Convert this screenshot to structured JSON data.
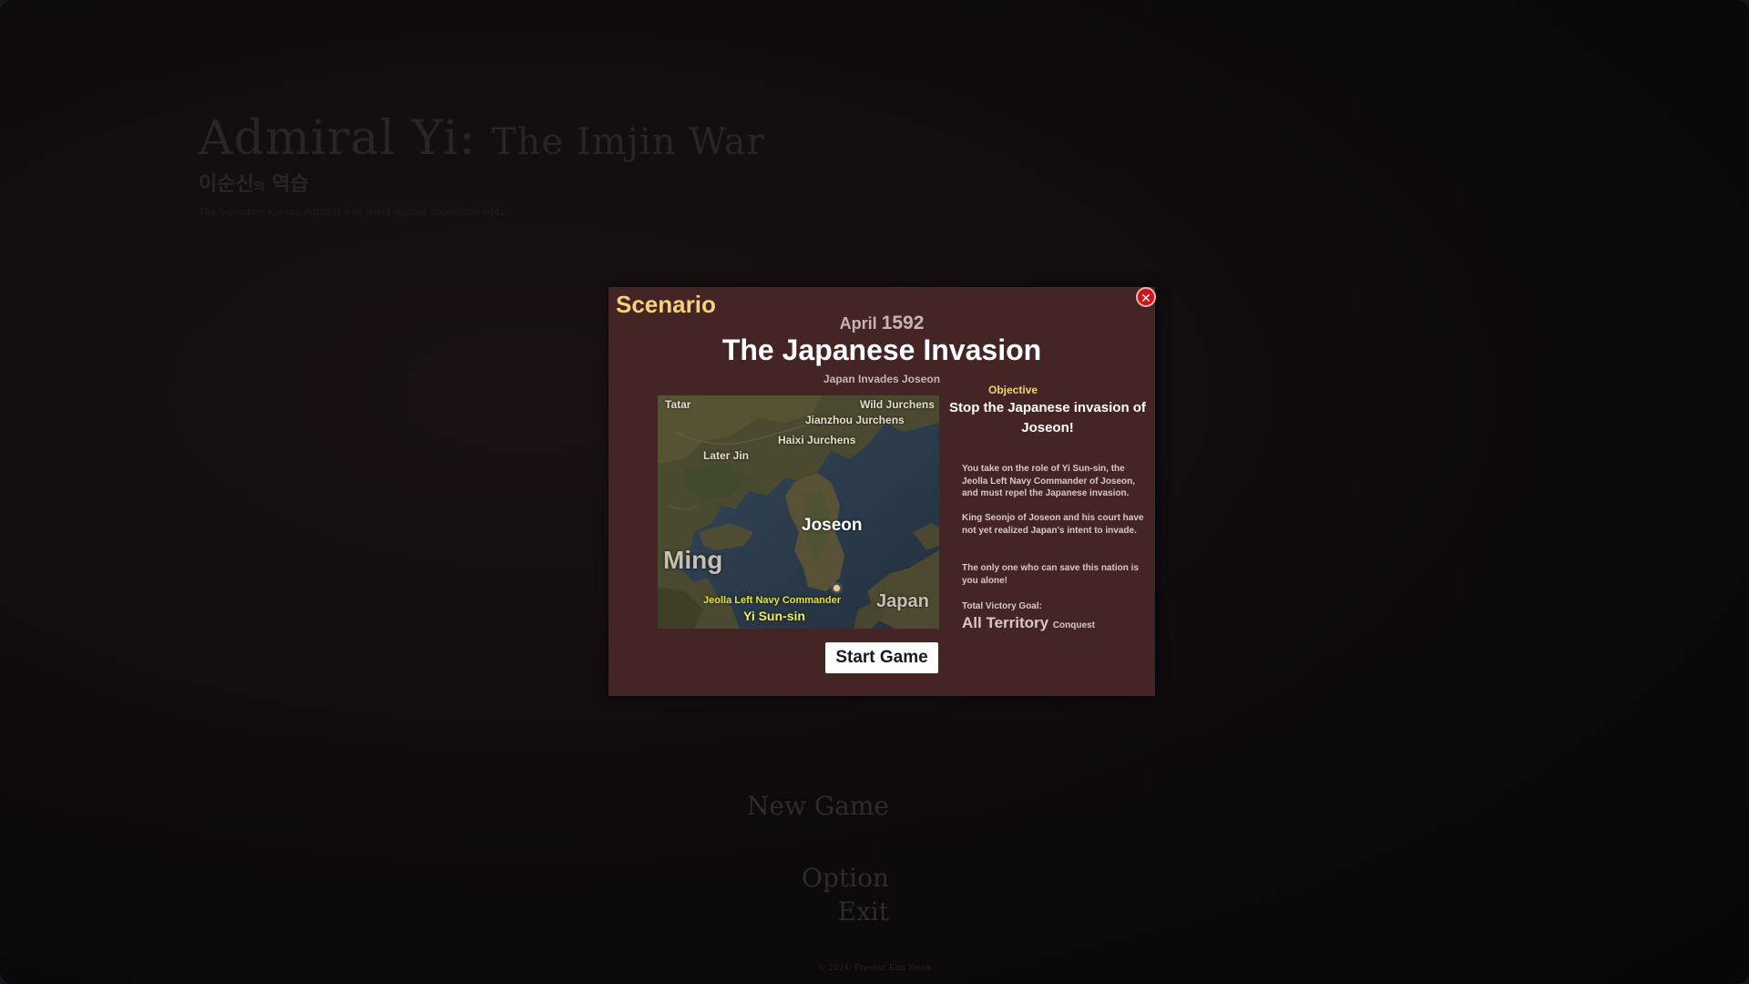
{
  "background": {
    "title_main": "Admiral Yi:",
    "title_sub": "The Imjin War",
    "title_korean_main": "이순신",
    "title_korean_small": "의",
    "title_korean_end": "역습",
    "tagline": "The legendary Korean Admiral who stood against impossible odds.",
    "menu": {
      "new_game": "New Game",
      "option": "Option",
      "exit": "Exit"
    },
    "copyright": "© 2024- Present Kim Yosok"
  },
  "modal": {
    "title": "Scenario",
    "close_symbol": "✕",
    "date_month": "April",
    "date_year": "1592",
    "scenario_name": "The Japanese Invasion",
    "scenario_subtitle": "Japan Invades Joseon",
    "map": {
      "labels": {
        "tatar": "Tatar",
        "wild_jurchens": "Wild Jurchens",
        "jianzhou_jurchens": "Jianzhou Jurchens",
        "haixi_jurchens": "Haixi Jurchens",
        "later_jin": "Later Jin",
        "joseon": "Joseon",
        "ming": "Ming",
        "japan": "Japan",
        "commander_title": "Jeolla Left Navy Commander",
        "commander_name": "Yi Sun-sin"
      }
    },
    "objective_label": "Objective",
    "objective_text": "Stop the Japanese invasion of Joseon!",
    "description": [
      "You take on the role of Yi Sun-sin, the Jeolla Left Navy Commander of Joseon, and must repel the Japanese invasion.",
      "King Seonjo of Joseon and his court have not yet realized Japan's intent to invade.",
      "The only one who can save this nation is you alone!"
    ],
    "goal_label": "Total Victory Goal:",
    "goal_value": "All Territory",
    "goal_type": "Conquest",
    "start_button": "Start Game"
  },
  "colors": {
    "modal_bg": "#452426",
    "accent_gold": "#f3d27a",
    "close_red": "#c8181c",
    "commander_yellow": "#f2ee5a"
  }
}
